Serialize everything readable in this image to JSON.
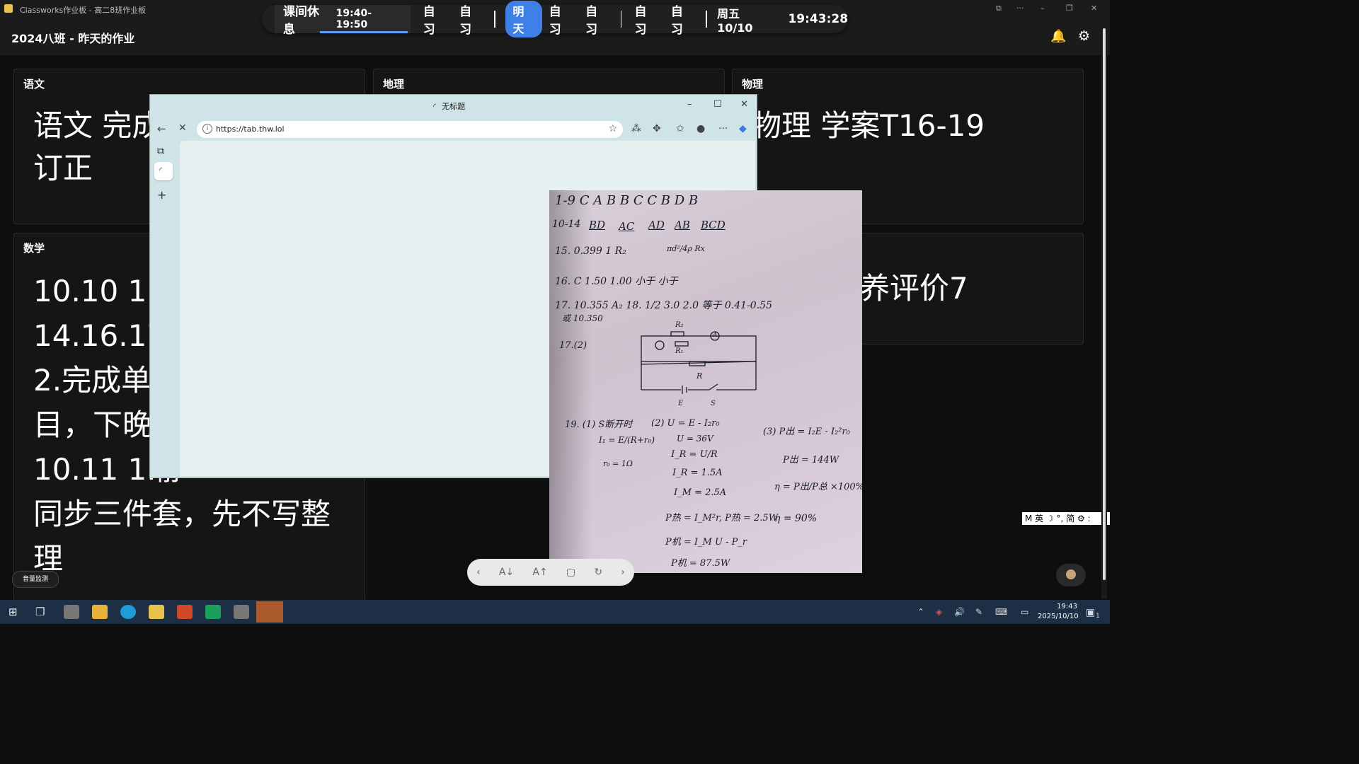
{
  "app": {
    "title": "Classworks作业板 - 高二8班作业板",
    "page_title": "2024八班 - 昨天的作业"
  },
  "schedule": {
    "current_name": "课间休息",
    "current_time": "19:40-19:50",
    "items_today": [
      "自习",
      "自习"
    ],
    "tomorrow_label": "明天",
    "items_tomorrow": [
      "自习",
      "自习"
    ],
    "items_after": [
      "自习",
      "自习"
    ],
    "date": "周五 10/10",
    "clock": "19:43:28"
  },
  "cards": {
    "chinese": {
      "title": "语文",
      "lines": [
        "语文 完成",
        "订正"
      ]
    },
    "geography": {
      "title": "地理"
    },
    "physics": {
      "title": "物理",
      "lines": [
        "物理 学案T16-19"
      ]
    },
    "math": {
      "title": "数学",
      "lines": [
        "10.10 1.整",
        "14.16.17是",
        "2.完成单",
        "目，下晚",
        "10.11 1.静",
        "同步三件套，先不写整",
        "理"
      ]
    },
    "right2": {
      "lines": [
        "养评价7"
      ]
    }
  },
  "browser": {
    "tab_title": "无标题",
    "url": "https://tab.thw.lol",
    "controls": {
      "minimize": "–",
      "maximize": "☐",
      "close": "✕"
    }
  },
  "handwriting": {
    "l1": "1-9  C A B B C   C B D B",
    "l2a": "10-14",
    "l2b": "BD",
    "l2c": "AC",
    "l2d": "AD",
    "l2e": "AB",
    "l2f": "BCD",
    "l3": "15.  0.399    1    R₂",
    "l3b": "πd²/4ρ Rx",
    "l4": "16.  C    1.50    1.00    小于 小于",
    "l5": "17.  10.355    A₂  18.  1/2    3.0    2.0   等于    0.41-0.55",
    "l5b": "或 10.350",
    "l6": "17.(2)",
    "r_a2": "R₂",
    "r_a1": "A",
    "r_r1": "R₁",
    "r_r": "R",
    "r_e": "E",
    "r_s": "S",
    "q19": "19.  (1)  S断开时",
    "q19a": "I₁ = E/(R+r₀)",
    "q19b": "r₀ = 1Ω",
    "q19c": "(2)  U = E - I₂r₀",
    "q19d": "U = 36V",
    "q19e": "I_R = U/R",
    "q19f": "I_R = 1.5A",
    "q19g": "I_M = 2.5A",
    "q19h": "P热 = I_M²r,  P热 = 2.5W",
    "q19i": "P机 = I_M U - P_r",
    "q19j": "P机 = 87.5W",
    "q19k": "(3)  P出 = I₂E - I₂²r₀",
    "q19l": "P出 = 144W",
    "q19m": "η = P出/P总 ×100%",
    "q19n": "η = 90%"
  },
  "bottom": {
    "volume_label": "音量监测"
  },
  "ime": {
    "text": "M 英 ☽ °, 简 ⚙ :"
  },
  "taskbar": {
    "time": "19:43",
    "date": "2025/10/10",
    "notif_count": "1"
  }
}
